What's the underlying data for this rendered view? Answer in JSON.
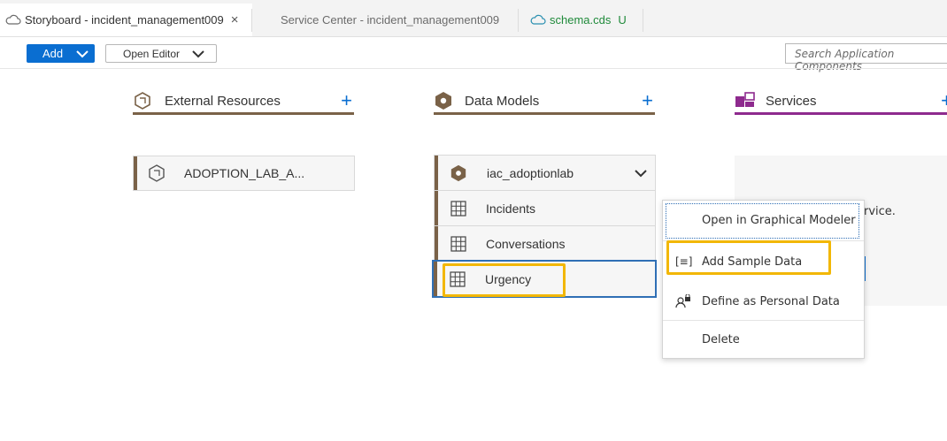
{
  "tabs": [
    {
      "label": "Storyboard - incident_management009",
      "close": "×"
    },
    {
      "label": "Service Center - incident_management009"
    },
    {
      "label": "schema.cds",
      "badge": "U"
    }
  ],
  "toolbar": {
    "add_label": "Add",
    "open_editor_label": "Open Editor",
    "search_placeholder": "Search Application Components"
  },
  "columns": {
    "external": {
      "title": "External Resources",
      "plus": "+",
      "color": "#7a6248"
    },
    "models": {
      "title": "Data Models",
      "plus": "+",
      "color": "#7a6248"
    },
    "services": {
      "title": "Services",
      "plus": "+",
      "color": "#8e2a8e"
    }
  },
  "external_card": {
    "label": "ADOPTION_LAB_A..."
  },
  "model_group": {
    "title": "iac_adoptionlab",
    "entities": [
      {
        "label": "Incidents"
      },
      {
        "label": "Conversations"
      },
      {
        "label": "Urgency"
      }
    ]
  },
  "services_hint": "rvice.",
  "context_menu": {
    "items": [
      {
        "label": "Open in Graphical Modeler"
      },
      {
        "label": "Add Sample Data",
        "icon": "[≡]"
      },
      {
        "label": "Define as Personal Data",
        "icon": "8̂"
      },
      {
        "label": "Delete"
      }
    ]
  },
  "colors": {
    "accent": "#0a6ed1",
    "highlight": "#f2b705",
    "model_brown": "#7a6248",
    "service_purple": "#8e2a8e"
  }
}
